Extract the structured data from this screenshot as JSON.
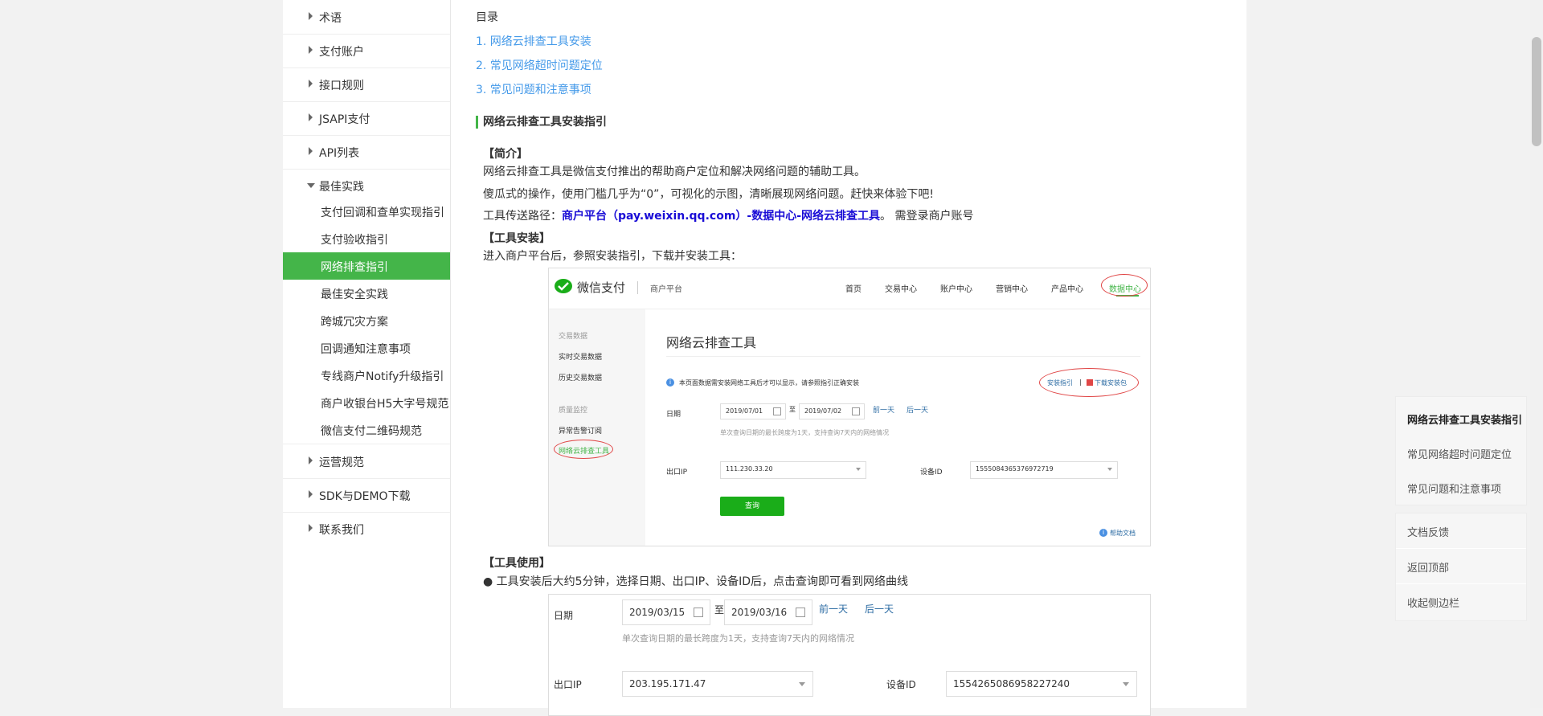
{
  "sidebar": {
    "nav": [
      {
        "label": "术语"
      },
      {
        "label": "支付账户"
      },
      {
        "label": "接口规则"
      },
      {
        "label": "JSAPI支付"
      },
      {
        "label": "API列表"
      },
      {
        "label": "最佳实践"
      },
      {
        "label": "运营规范"
      },
      {
        "label": "SDK与DEMO下载"
      },
      {
        "label": "联系我们"
      }
    ],
    "subitems": [
      {
        "label": "支付回调和查单实现指引"
      },
      {
        "label": "支付验收指引"
      },
      {
        "label": "网络排查指引"
      },
      {
        "label": "最佳安全实践"
      },
      {
        "label": "跨城冗灾方案"
      },
      {
        "label": "回调通知注意事项"
      },
      {
        "label": "专线商户Notify升级指引"
      },
      {
        "label": "商户收银台H5大字号规范"
      },
      {
        "label": "微信支付二维码规范"
      }
    ]
  },
  "content": {
    "toc_title": "目录",
    "toc": [
      "1. 网络云排查工具安装",
      "2. 常见网络超时问题定位",
      "3. 常见问题和注意事项"
    ],
    "section_title": "网络云排查工具安装指引",
    "intro_heading": "【简介】",
    "intro_p1": "网络云排查工具是微信支付推出的帮助商户定位和解决网络问题的辅助工具。",
    "intro_p2": "傻瓜式的操作，使用门槛几乎为“0”，可视化的示图，清晰展现网络问题。赶快来体验下吧!",
    "path_prefix": "工具传送路径：",
    "path_link": "商户平台（pay.weixin.qq.com）-数据中心-网络云排查工具",
    "path_suffix": "。 需登录商户账号",
    "install_heading": "【工具安装】",
    "install_text": "进入商户平台后，参照安装指引，下载并安装工具：",
    "usage_heading": "【工具使用】",
    "usage_bullet": "● 工具安装后大约5分钟，选择日期、出口IP、设备ID后，点击查询即可看到网络曲线"
  },
  "shot1": {
    "brand": "微信支付",
    "merchant": "商户平台",
    "nav": [
      "首页",
      "交易中心",
      "账户中心",
      "营销中心",
      "产品中心",
      "数据中心"
    ],
    "left_group1": "交易数据",
    "left_items1": [
      "实时交易数据",
      "历史交易数据"
    ],
    "left_group2": "质量监控",
    "left_items2": [
      "异常告警订阅",
      "网络云排查工具"
    ],
    "title": "网络云排查工具",
    "notice": "本页面数据需安装网络工具后才可以显示，请参照指引正确安装",
    "install_guide": "安装指引",
    "divider": "|",
    "download": "下载安装包",
    "date_label": "日期",
    "date_from": "2019/07/01",
    "to": "至",
    "date_to": "2019/07/02",
    "prev_day": "前一天",
    "next_day": "后一天",
    "date_hint": "单次查询日期的最长跨度为1天，支持查询7天内的网络情况",
    "ip_label": "出口IP",
    "ip_value": "111.230.33.20",
    "device_label": "设备ID",
    "device_value": "1555084365376972719",
    "query_button": "查询",
    "help_doc": "帮助文档"
  },
  "shot2": {
    "date_label": "日期",
    "date_from": "2019/03/15",
    "to": "至",
    "date_to": "2019/03/16",
    "prev_day": "前一天",
    "next_day": "后一天",
    "date_hint": "单次查询日期的最长跨度为1天，支持查询7天内的网络情况",
    "ip_label": "出口IP",
    "ip_value": "203.195.171.47",
    "device_label": "设备ID",
    "device_value": "1554265086958227240"
  },
  "float_toc": [
    "网络云排查工具安装指引",
    "常见网络超时问题定位",
    "常见问题和注意事项"
  ],
  "float_tools": [
    "文档反馈",
    "返回顶部",
    "收起侧边栏"
  ],
  "colors": {
    "accent": "#44b549",
    "link": "#459ae9",
    "path_link": "#1a0dd6",
    "ellipse": "#e04646"
  }
}
